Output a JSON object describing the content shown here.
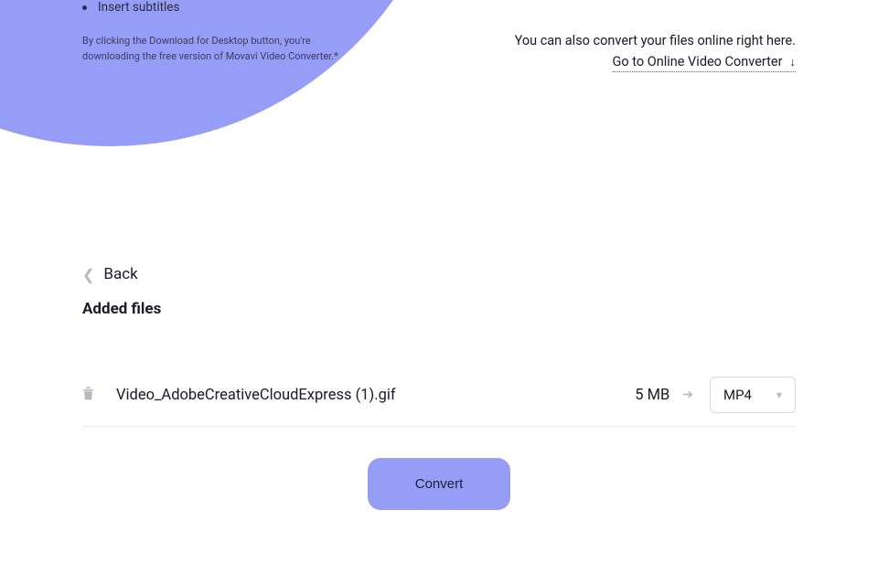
{
  "hero": {
    "bullet": "Insert subtitles",
    "disclaimer": "By clicking the Download for Desktop button, you're downloading the free version of Movavi Video Converter.*"
  },
  "online": {
    "note": "You can also convert your files online right here.",
    "link": "Go to Online Video Converter"
  },
  "back_label": "Back",
  "section_title": "Added files",
  "file": {
    "name": "Video_AdobeCreativeCloudExpress (1).gif",
    "size": "5 MB",
    "format": "MP4"
  },
  "convert_label": "Convert"
}
